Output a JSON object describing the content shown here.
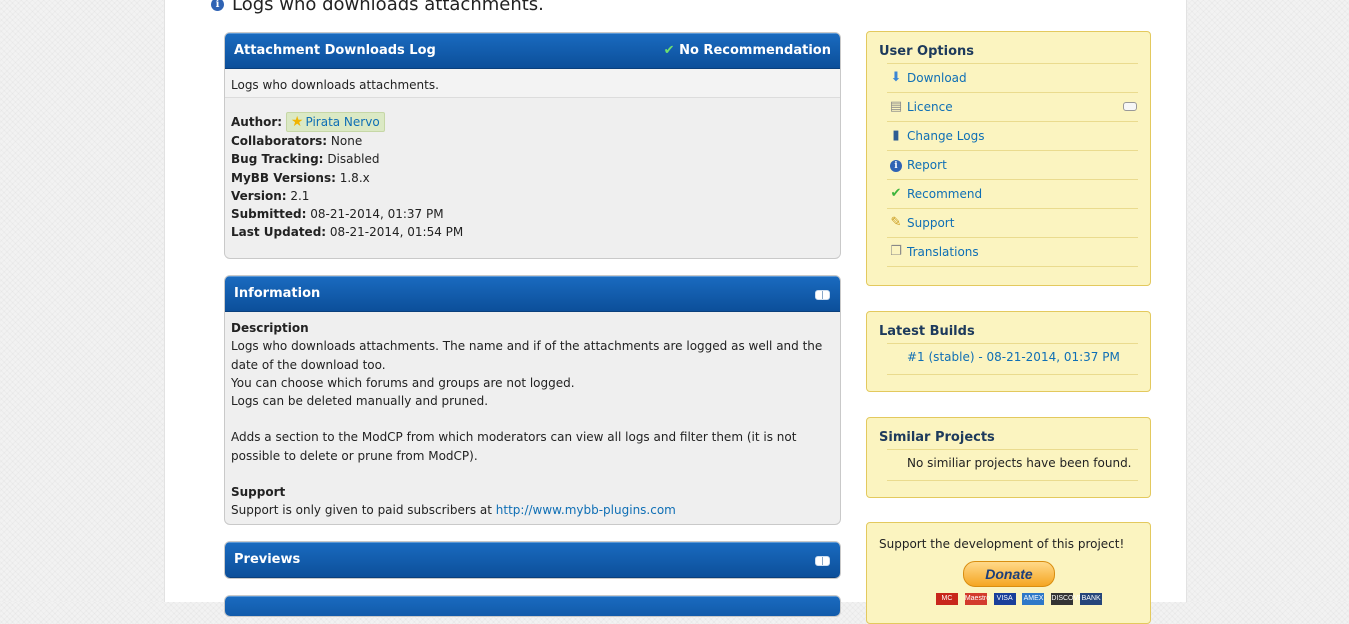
{
  "page_title": "Logs who downloads attachments.",
  "main_box": {
    "title": "Attachment Downloads Log",
    "recommendation": "No Recommendation",
    "short_description": "Logs who downloads attachments.",
    "meta": [
      {
        "label": "Author:",
        "value": "Pirata Nervo",
        "link": true
      },
      {
        "label": "Collaborators:",
        "value": "None"
      },
      {
        "label": "Bug Tracking:",
        "value": "Disabled"
      },
      {
        "label": "MyBB Versions:",
        "value": "1.8.x"
      },
      {
        "label": "Version:",
        "value": "2.1"
      },
      {
        "label": "Submitted:",
        "value": "08-21-2014, 01:37 PM"
      },
      {
        "label": "Last Updated:",
        "value": "08-21-2014, 01:54 PM"
      }
    ]
  },
  "information": {
    "title": "Information",
    "description_heading": "Description",
    "line1": "Logs who downloads attachments. The name and if of the attachments are logged as well and the date of the download too.",
    "line2": "You can choose which forums and groups are not logged.",
    "line3": "Logs can be deleted manually and pruned.",
    "line4": "Adds a section to the ModCP from which moderators can view all logs and filter them (it is not possible to delete or prune from ModCP).",
    "support_heading": "Support",
    "support_text": "Support is only given to paid subscribers at ",
    "support_link": "http://www.mybb-plugins.com"
  },
  "previews": {
    "title": "Previews"
  },
  "user_options": {
    "title": "User Options",
    "items": [
      {
        "label": "Download",
        "icon": "download-arrow-icon"
      },
      {
        "label": "Licence",
        "icon": "document-icon"
      },
      {
        "label": "Change Logs",
        "icon": "book-icon"
      },
      {
        "label": "Report",
        "icon": "info-icon"
      },
      {
        "label": "Recommend",
        "icon": "checkmark-icon"
      },
      {
        "label": "Support",
        "icon": "pencil-icon"
      },
      {
        "label": "Translations",
        "icon": "copy-pages-icon"
      }
    ]
  },
  "latest_builds": {
    "title": "Latest Builds",
    "build": "#1 (stable) - 08-21-2014, 01:37 PM"
  },
  "similar_projects": {
    "title": "Similar Projects",
    "empty_text": "No similiar projects have been found."
  },
  "donate_box": {
    "text": "Support the development of this project!",
    "button": "Donate",
    "cards": [
      "MC",
      "Maestro",
      "VISA",
      "AMEX",
      "DISCOVER",
      "BANK"
    ]
  },
  "colors": {
    "header_blue": "#0c4f9a",
    "sidebar_yellow": "#fbf4c0",
    "link_blue": "#0f6fb5",
    "check_green": "#3cb43c"
  }
}
